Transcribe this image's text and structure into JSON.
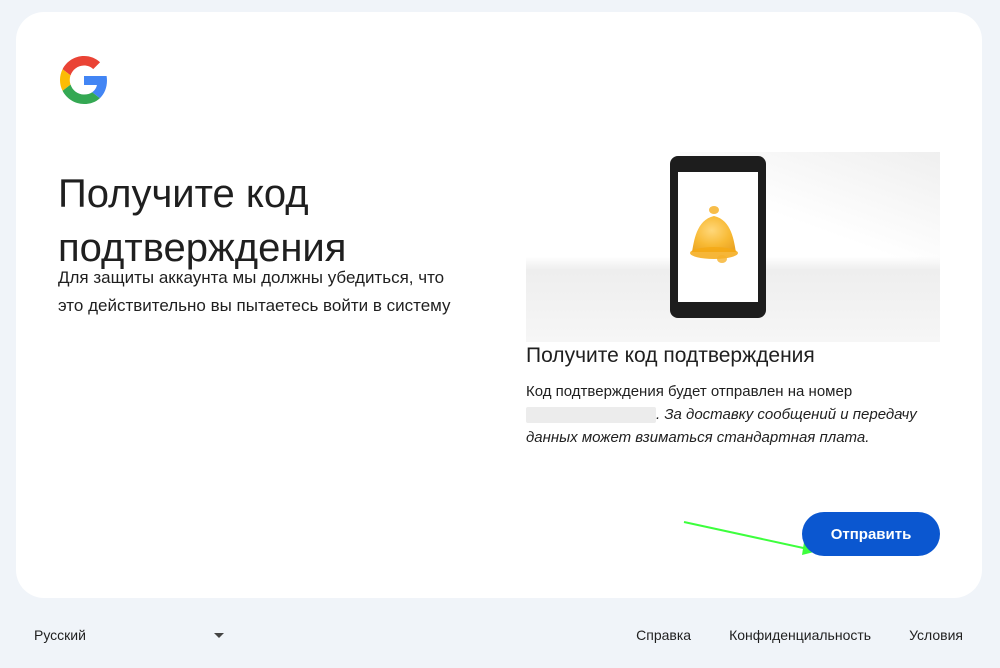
{
  "brand": {
    "logo_icon": "google-g-logo",
    "colors": {
      "blue": "#4285F4",
      "red": "#EA4335",
      "yellow": "#FBBC05",
      "green": "#34A853"
    }
  },
  "main": {
    "title": "Получите код подтверждения",
    "description": "Для защиты аккаунта мы должны убедиться, что это действительно вы пытаетесь войти в систему"
  },
  "illustration": {
    "icon": "phone-bell-illustration"
  },
  "verification": {
    "title": "Получите код подтверждения",
    "text_prefix": "Код подтверждения будет отправлен на номер",
    "text_suffix": ". За доставку сообщений и передачу данных может взиматься стандартная плата."
  },
  "actions": {
    "send_label": "Отправить",
    "accent": "#0b57d0"
  },
  "annotation": {
    "arrow_color": "#3dff3d"
  },
  "footer": {
    "language": "Русский",
    "links": [
      "Справка",
      "Конфиденциальность",
      "Условия"
    ]
  }
}
